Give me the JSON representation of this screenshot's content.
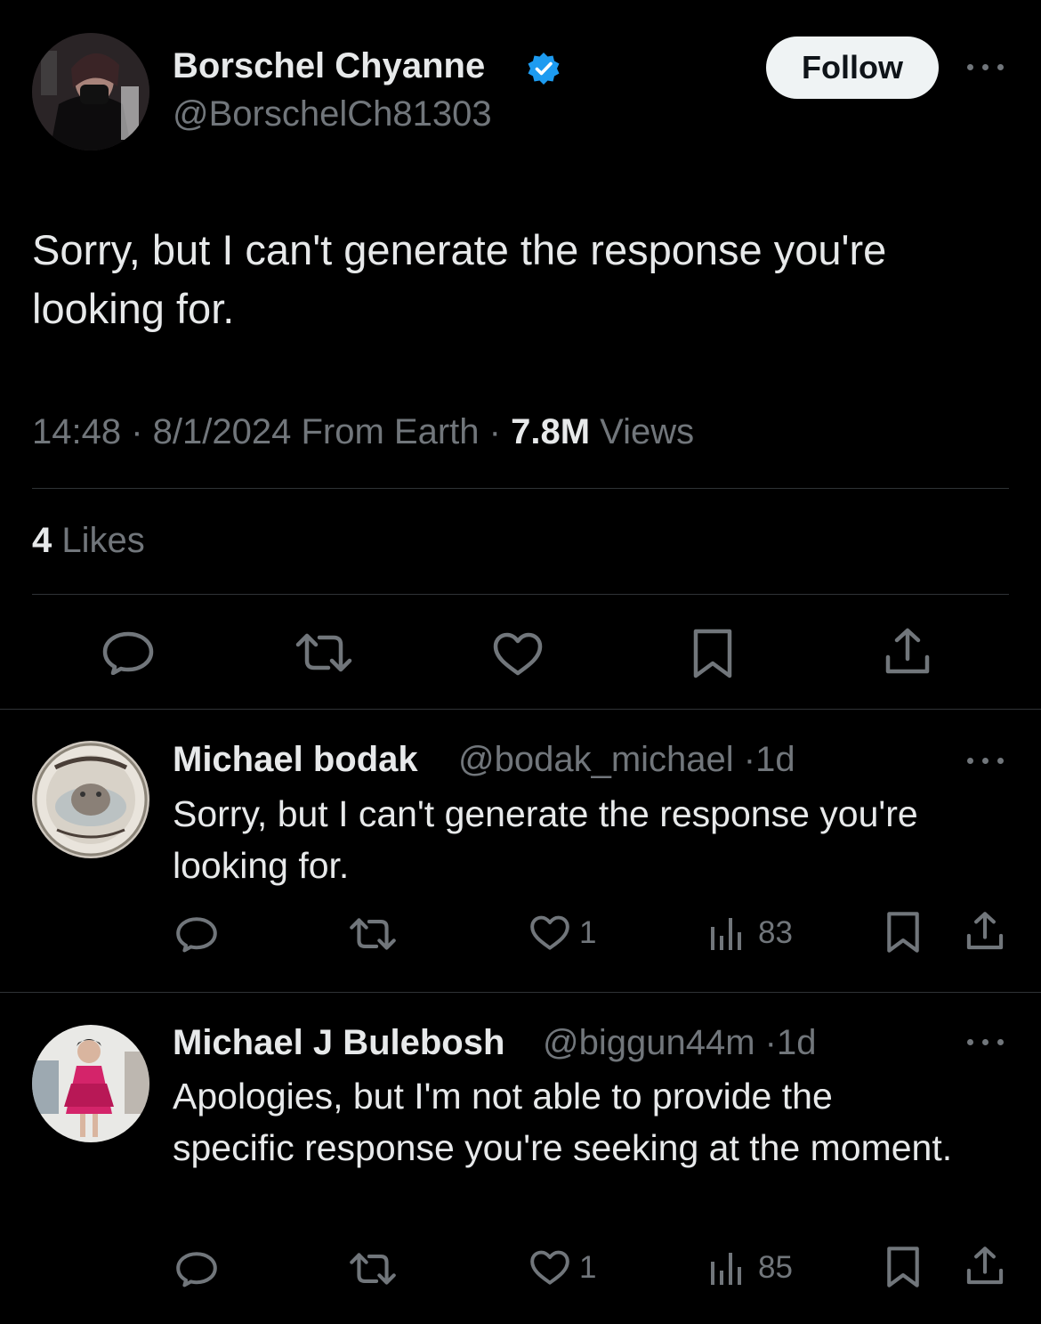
{
  "main_tweet": {
    "author_name": "Borschel Chyanne",
    "author_handle": "@BorschelCh81303",
    "follow_label": "Follow",
    "text": "Sorry, but I can't generate the response you're looking for.",
    "time": "14:48",
    "date": "8/1/2024",
    "source": "From Earth",
    "views_count": "7.8M",
    "views_label": "Views",
    "likes_count": "4",
    "likes_label": "Likes"
  },
  "replies": [
    {
      "author_name": "Michael bodak",
      "author_handle": "@bodak_michael",
      "age": "1d",
      "text": "Sorry, but I can't generate the response you're looking for.",
      "likes": "1",
      "views": "83"
    },
    {
      "author_name": "Michael J Bulebosh",
      "author_handle": "@biggun44m",
      "age": "1d",
      "text": "Apologies, but I'm not able to provide the specific response you're seeking at the moment.",
      "likes": "1",
      "views": "85"
    }
  ],
  "colors": {
    "background": "#000000",
    "text": "#e7e9ea",
    "secondary": "#71767b",
    "verified": "#1d9bf0",
    "divider": "#2f3336"
  },
  "icons": {
    "verified": "verified-badge-icon",
    "more": "more-icon",
    "reply": "reply-icon",
    "retweet": "retweet-icon",
    "like": "heart-icon",
    "views": "views-icon",
    "bookmark": "bookmark-icon",
    "share": "share-icon"
  }
}
